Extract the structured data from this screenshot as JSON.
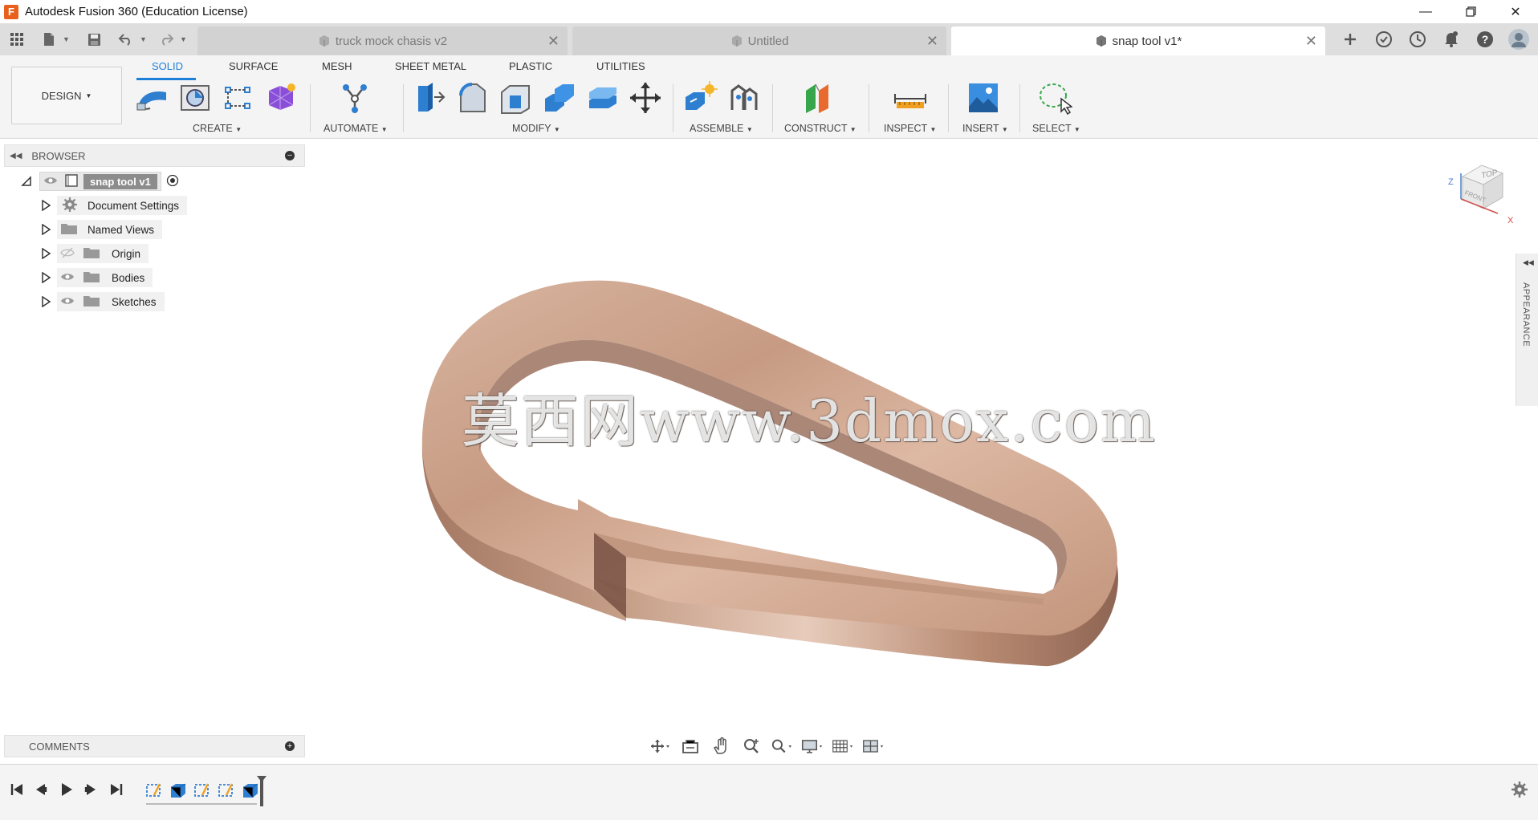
{
  "titlebar": {
    "title": "Autodesk Fusion 360 (Education License)",
    "logo": "F"
  },
  "tabs": [
    {
      "label": "truck mock chasis v2",
      "active": false
    },
    {
      "label": "Untitled",
      "active": false
    },
    {
      "label": "snap tool v1*",
      "active": true
    }
  ],
  "toolbar": {
    "workspace": "DESIGN",
    "workspace_tabs": [
      "SOLID",
      "SURFACE",
      "MESH",
      "SHEET METAL",
      "PLASTIC",
      "UTILITIES"
    ],
    "groups": [
      "CREATE",
      "AUTOMATE",
      "MODIFY",
      "ASSEMBLE",
      "CONSTRUCT",
      "INSPECT",
      "INSERT",
      "SELECT"
    ]
  },
  "browser": {
    "title": "BROWSER",
    "root": "snap tool v1",
    "items": [
      "Document Settings",
      "Named Views",
      "Origin",
      "Bodies",
      "Sketches"
    ]
  },
  "comments": {
    "title": "COMMENTS"
  },
  "viewcube": {
    "top": "TOP",
    "front": "FRONT",
    "axis_z": "Z",
    "axis_x": "X"
  },
  "side_panel": {
    "label": "APPEARANCE"
  },
  "watermark": "莫西网www.3dmox.com",
  "colors": {
    "accent": "#1e7fd9",
    "model": "#c99e86",
    "brand": "#e8601c"
  }
}
